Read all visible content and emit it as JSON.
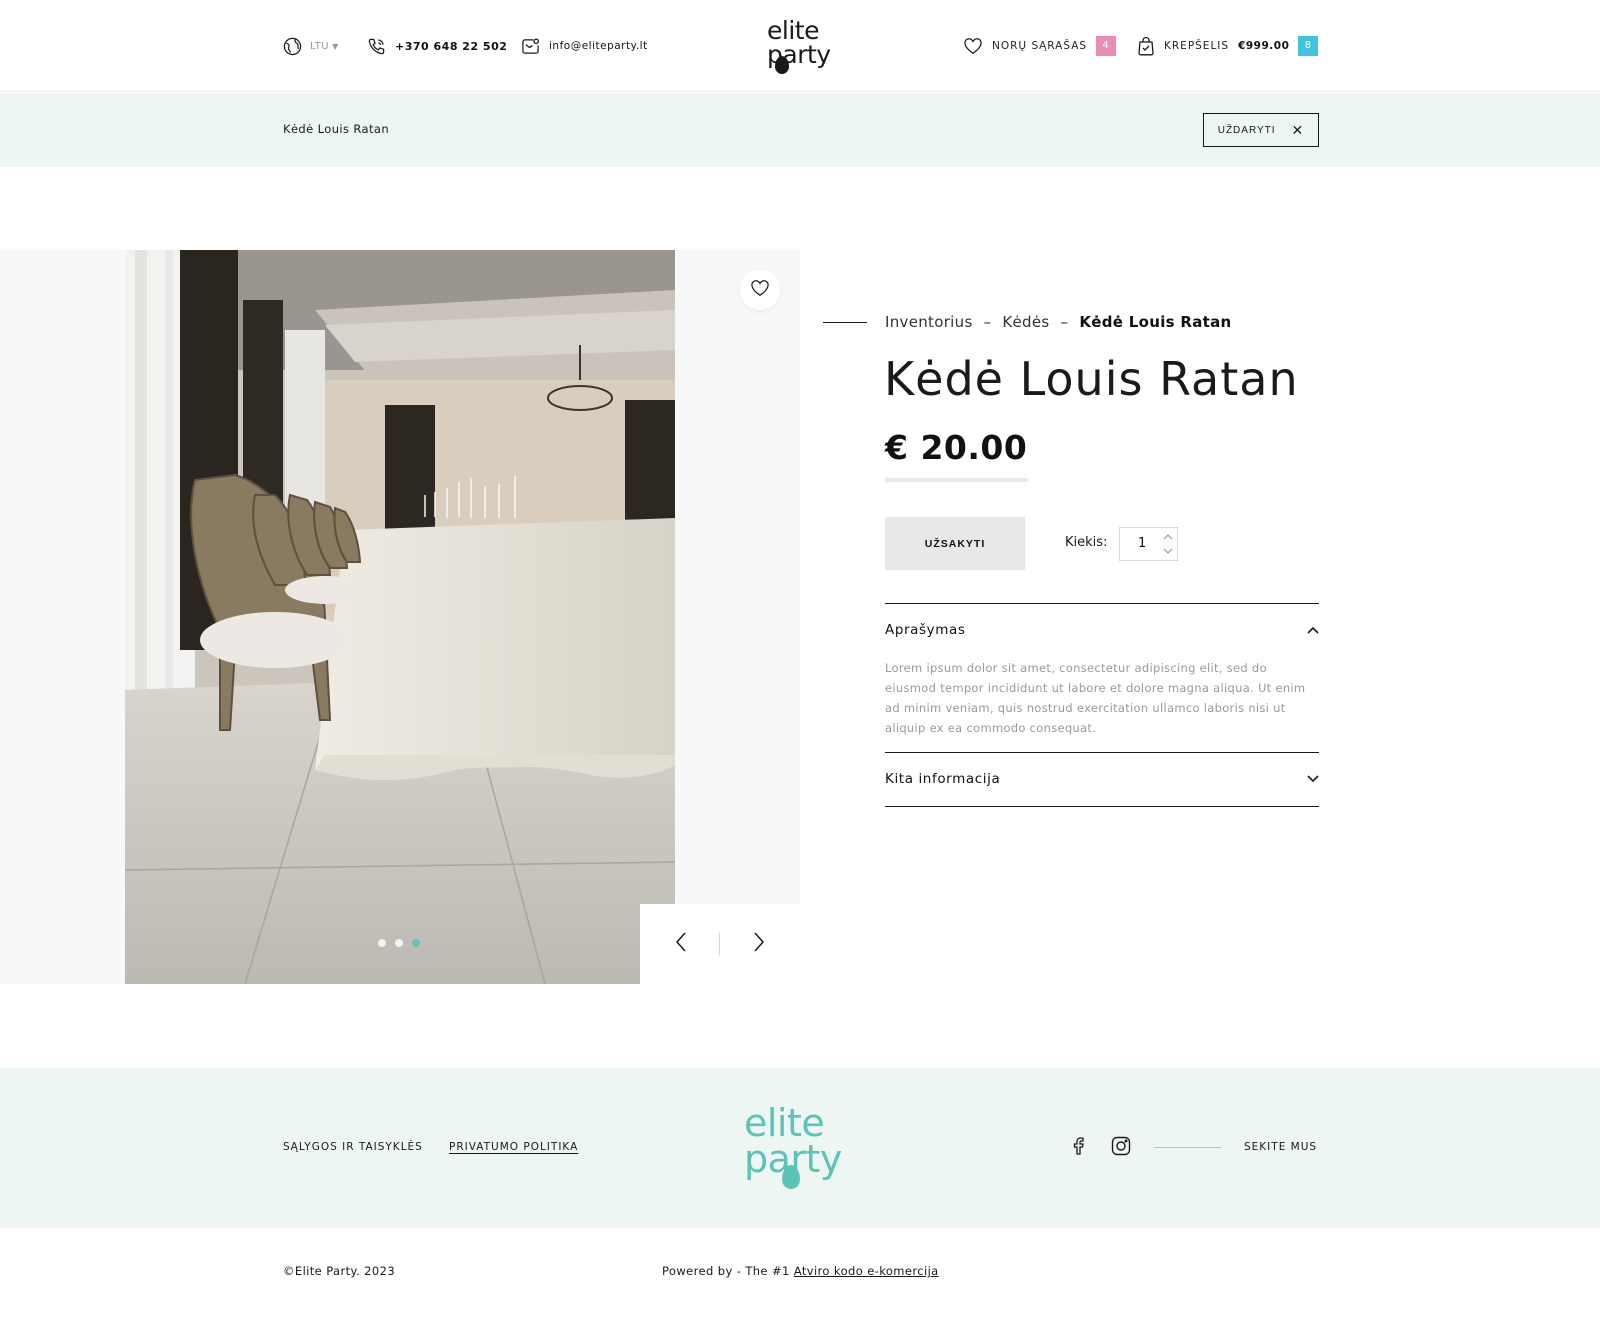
{
  "header": {
    "currency": "LTU",
    "phone": "+370 648 22 502",
    "email": "info@eliteparty.lt",
    "logo_line1": "elite",
    "logo_line2": "party",
    "wishlist_label": "NORŲ SĄRAŠAS",
    "wishlist_count": "4",
    "cart_label": "KREPŠELIS",
    "cart_total": "€999.00",
    "cart_count": "8",
    "icons": [
      "globe-icon",
      "phone-icon",
      "email-icon",
      "heart-icon",
      "shopping-bag-icon"
    ],
    "colors": {
      "wishlist_badge": "#ea8db6",
      "cart_badge": "#40c4de"
    }
  },
  "notice": {
    "title": "Kėdė Louis Ratan",
    "close_label": "UŽDARYTI"
  },
  "gallery": {
    "slides": 3,
    "active_slide": 3,
    "accent": "#5bc4b6"
  },
  "product": {
    "breadcrumbs": [
      "Inventorius",
      "Kėdės",
      "Kėdė Louis Ratan"
    ],
    "breadcrumb_sep": "–",
    "title": "Kėdė Louis Ratan",
    "price": "€ 20.00",
    "order_label": "UŽSAKYTI",
    "qty_label": "Kiekis:",
    "qty_value": "1",
    "accordion": [
      {
        "title": "Aprašymas",
        "expanded": true,
        "body": "Lorem ipsum dolor sit amet, consectetur adipiscing elit, sed do eiusmod tempor incididunt ut labore et dolore magna aliqua. Ut enim ad minim veniam, quis nostrud exercitation ullamco laboris nisi ut aliquip ex ea commodo consequat."
      },
      {
        "title": "Kita informacija",
        "expanded": false
      }
    ]
  },
  "footer": {
    "terms": "SĄLYGOS IR TAISYKLĖS",
    "privacy": "PRIVATUMO POLITIKA",
    "logo_line1": "elite",
    "logo_line2": "party",
    "follow": "SEKITE MUS",
    "copyright": "©Elite Party. 2023",
    "powered_prefix": "Powered by - The #1",
    "powered_link": "Atviro kodo e-komercija",
    "logo_color": "#5bc4b6"
  }
}
